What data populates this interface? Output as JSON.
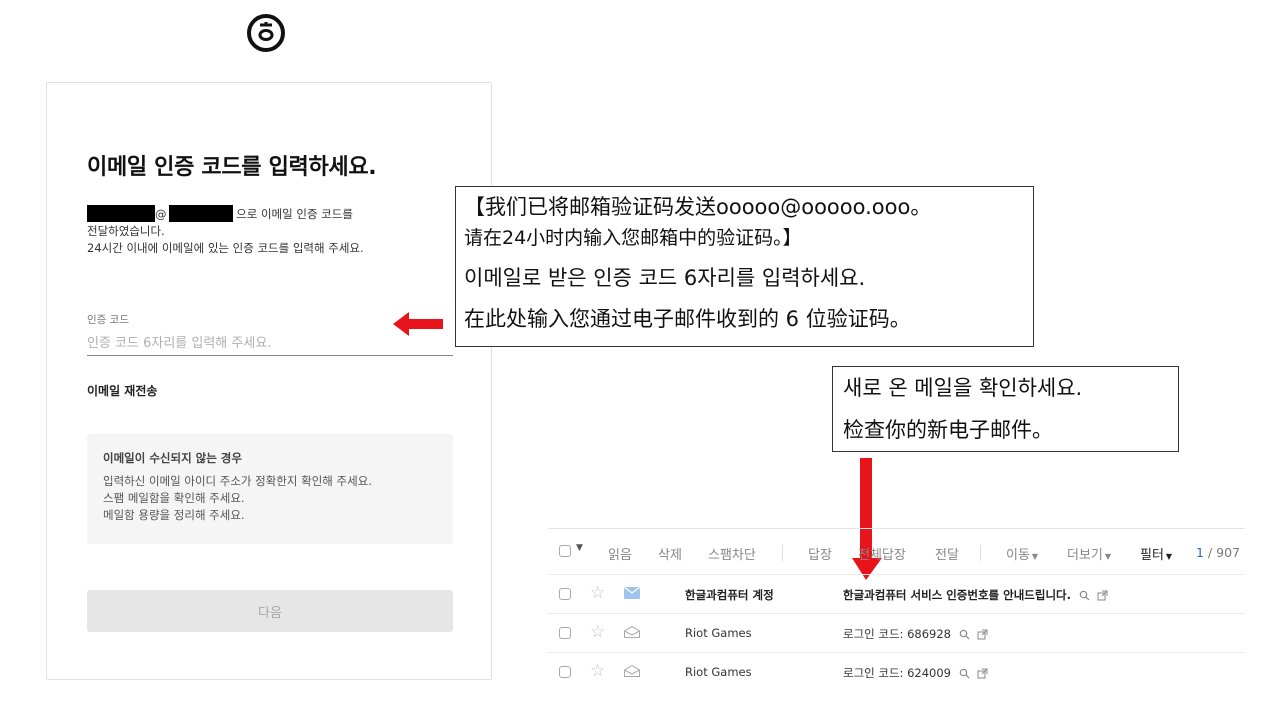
{
  "login": {
    "title": "이메일 인증 코드를 입력하세요.",
    "desc_at": "@",
    "desc_suffix": " 으로 이메일 인증 코드를",
    "desc_line2": "전달하였습니다.",
    "desc_line3": "24시간 이내에 이메일에 있는 인증 코드를 입력해 주세요.",
    "code_label": "인증 코드",
    "code_placeholder": "인증 코드 6자리를 입력해 주세요.",
    "resend": "이메일 재전송",
    "help_title": "이메일이 수신되지 않는 경우",
    "help_lines": [
      "입력하신 이메일 아이디 주소가 정확한지 확인해 주세요.",
      "스팸 메일함을 확인해 주세요.",
      "메일함 용량을 정리해 주세요."
    ],
    "next_button": "다음"
  },
  "annotations": {
    "box1": {
      "zh_line1": "【我们已将邮箱验证码发送ooooo@ooooo.ooo。",
      "zh_line2": "请在24小时内输入您邮箱中的验证码。】",
      "ko_line": "이메일로 받은 인증 코드 6자리를 입력하세요.",
      "zh_line3": "在此处输入您通过电子邮件收到的 6 位验证码。"
    },
    "box2": {
      "ko_line": "새로 온 메일을 확인하세요.",
      "zh_line": "检查你的新电子邮件。"
    },
    "arrow_color": "#e8141c"
  },
  "mail": {
    "toolbar": {
      "read": "읽음",
      "delete": "삭제",
      "spam": "스팸차단",
      "reply": "답장",
      "reply_all": "전체답장",
      "forward": "전달",
      "move": "이동",
      "more": "더보기",
      "filter": "필터",
      "page_current": "1",
      "page_total": " / 907"
    },
    "rows": [
      {
        "from": "한글과컴퓨터 계정",
        "subject": "한글과컴퓨터 서비스 인증번호를 안내드립니다.",
        "unread": true
      },
      {
        "from": "Riot Games",
        "subject": "로그인 코드: 686928",
        "unread": false
      },
      {
        "from": "Riot Games",
        "subject": "로그인 코드: 624009",
        "unread": false
      }
    ],
    "accent_color": "#3366cc"
  }
}
